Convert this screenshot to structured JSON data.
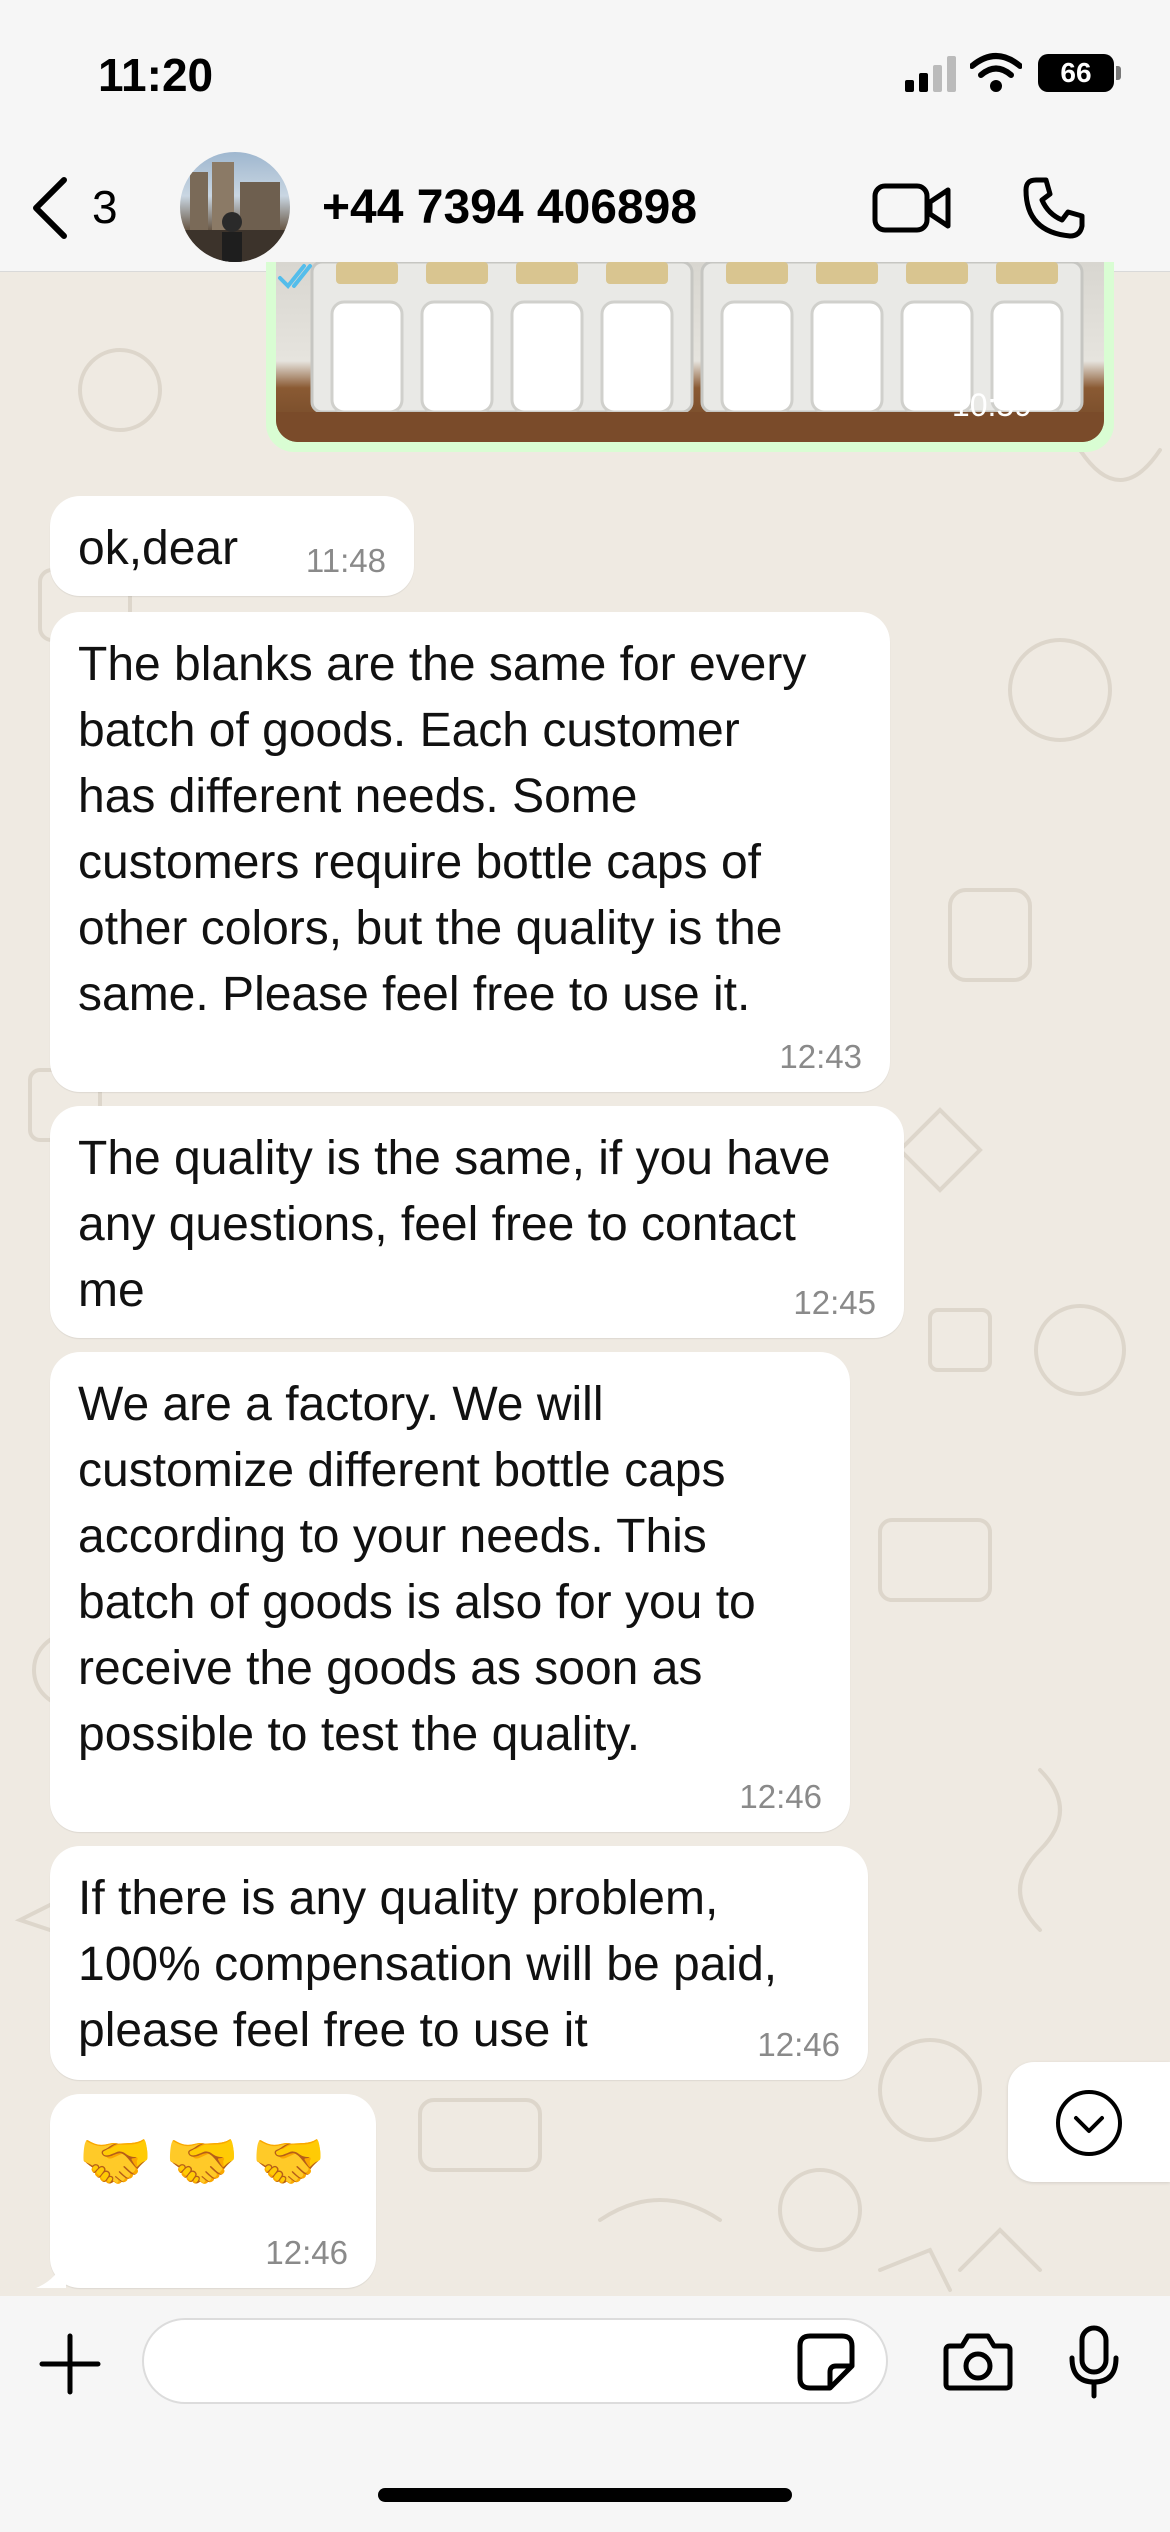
{
  "status_bar": {
    "time": "11:20",
    "battery": "66"
  },
  "header": {
    "back_count": "3",
    "contact_name": "+44 7394 406898"
  },
  "media_message": {
    "time": "10:59",
    "read_status": "read",
    "tick_color": "#53bdeb"
  },
  "messages": [
    {
      "text": "ok,dear",
      "time": "11:48"
    },
    {
      "text": "The blanks are the same for every\nbatch of goods. Each customer\nhas different needs. Some\ncustomers require bottle caps of\nother colors, but the quality is the\nsame. Please feel free to use it.",
      "time": "12:43"
    },
    {
      "text": "The quality is the same, if you have\nany questions, feel free to contact\nme",
      "time": "12:45"
    },
    {
      "text": "We are a factory. We will\ncustomize different bottle caps\naccording to your needs. This\nbatch of goods is also for you to\nreceive the goods as soon as\npossible to test the quality.",
      "time": "12:46"
    },
    {
      "text": "If there is any quality problem,\n100% compensation will be paid,\nplease feel free to use it",
      "time": "12:46"
    },
    {
      "text": "🤝🤝🤝",
      "time": "12:46"
    }
  ],
  "input": {
    "placeholder": "",
    "value": ""
  },
  "colors": {
    "chat_background": "#efeae2",
    "outgoing_bubble": "#d9fdd3",
    "incoming_bubble": "#ffffff",
    "accent_blue": "#007aff"
  },
  "icons": {
    "back": "chevron-left-icon",
    "video": "video-camera-icon",
    "phone": "phone-icon",
    "scroll": "chevron-down-circle-icon",
    "plus": "plus-icon",
    "sticker": "sticker-icon",
    "camera": "camera-icon",
    "mic": "microphone-icon"
  }
}
